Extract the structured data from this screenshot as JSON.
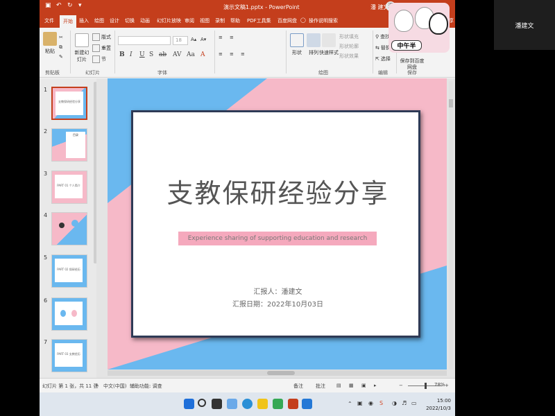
{
  "participant": {
    "name": "潘建文"
  },
  "titlebar": {
    "title": "演示文稿1.pptx - PowerPoint",
    "user": "潘 建文",
    "avatar_initial": "潘"
  },
  "tabs": [
    "文件",
    "开始",
    "插入",
    "绘图",
    "设计",
    "切换",
    "动画",
    "幻灯片放映",
    "审阅",
    "视图",
    "录制",
    "帮助",
    "PDF工具集",
    "百度网盘",
    "操作说明搜索",
    "共享"
  ],
  "active_tab": "开始",
  "ribbon": {
    "paste": "粘贴",
    "new_slide": "新建幻灯片",
    "layout": "版式",
    "reset": "重置",
    "section": "节",
    "shapes": "形状",
    "arrange": "排列",
    "quick_styles": "快速样式",
    "shape_fill": "形状填充",
    "shape_outline": "形状轮廓",
    "shape_effects": "形状效果",
    "find": "查找",
    "replace": "替换",
    "select": "选择",
    "save_to_baidu": "保存到百度网盘",
    "font_size_value": "18",
    "groups": [
      "剪贴板",
      "幻灯片",
      "字体",
      "绘图",
      "编辑",
      "保存"
    ],
    "sticker_text": "中午半"
  },
  "thumbnails": [
    {
      "num": "1",
      "text": "支教保研经验分享"
    },
    {
      "num": "2",
      "text": "目录"
    },
    {
      "num": "3",
      "text": "PART 01 个人简介"
    },
    {
      "num": "4",
      "text": ""
    },
    {
      "num": "5",
      "text": "PART 02 保研经历"
    },
    {
      "num": "6",
      "text": ""
    },
    {
      "num": "7",
      "text": "PART 03 支教经历"
    }
  ],
  "slide": {
    "title": "支教保研经验分享",
    "subtitle": "Experience sharing of supporting education and research",
    "reporter": "汇报人：潘建文",
    "date": "汇报日期：2022年10月03日"
  },
  "status": {
    "slide_info": "幻灯片 第 1 张，共 11 张",
    "language": "中文(中国)",
    "accessibility": "辅助功能: 调查",
    "notes": "备注",
    "comments": "批注",
    "zoom": "78%"
  },
  "taskbar": {
    "time": "15:00",
    "date": "2022/10/3"
  },
  "colors": {
    "accent": "#c43e1c",
    "slide_blue": "#6ab8ef",
    "slide_pink": "#f6b9c8",
    "band_pink": "#f5a9bd",
    "card_border": "#2e3a56"
  }
}
